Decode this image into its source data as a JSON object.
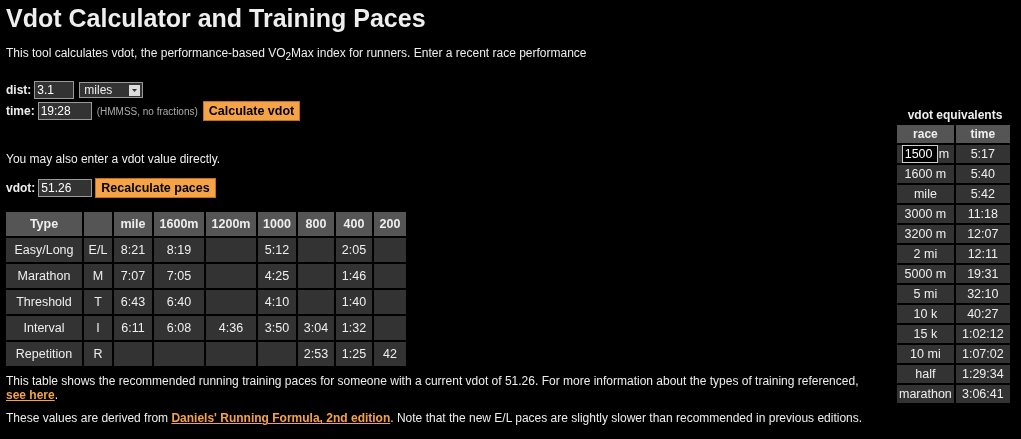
{
  "title": "Vdot Calculator and Training Paces",
  "intro": "This tool calculates vdot, the performance-based VO$_{2}$Max index for runners. Enter a recent race performance",
  "race_form": {
    "dist_label": "dist:",
    "dist_value": "3.1",
    "unit": "miles",
    "time_label": "time:",
    "time_value": "19:28",
    "time_hint": "(HMMSS, no fractions)",
    "button": "Calculate vdot"
  },
  "direct_note": "You may also enter a vdot value directly.",
  "vdot_form": {
    "label": "vdot:",
    "value": "51.26",
    "button": "Recalculate paces"
  },
  "pace_table": {
    "columns": [
      "Type",
      null,
      "mile",
      "1600m",
      "1200m",
      "1000",
      "800",
      "400",
      "200"
    ],
    "rows": [
      [
        "Easy/Long",
        "E/L",
        "8:21",
        "8:19",
        null,
        "5:12",
        null,
        "2:05",
        null
      ],
      [
        "Marathon",
        "M",
        "7:07",
        "7:05",
        null,
        "4:25",
        null,
        "1:46",
        null
      ],
      [
        "Threshold",
        "T",
        "6:43",
        "6:40",
        null,
        "4:10",
        null,
        "1:40",
        null
      ],
      [
        "Interval",
        "I",
        "6:11",
        "6:08",
        "4:36",
        "3:50",
        "3:04",
        "1:32",
        null
      ],
      [
        "Repetition",
        "R",
        null,
        null,
        null,
        null,
        "2:53",
        "1:25",
        "42"
      ]
    ]
  },
  "paragraphs": [
    {
      "before": "This table shows the recommended running training paces for someone with a current vdot of 51.26. For more information about the types of training referenced, ",
      "link": "see here",
      "after": "."
    },
    {
      "before": "These values are derived from ",
      "link": "Daniels' Running Formula, 2nd edition",
      "after": ". Note that the new E/L paces are slightly slower than recommended in previous editions."
    }
  ],
  "equivalents": {
    "title": "vdot equivalents",
    "columns": [
      "race",
      "time"
    ],
    "rows": [
      {
        "kind": "input",
        "race": "1500",
        "unit": "m",
        "time": "5:17"
      },
      {
        "kind": "text",
        "race": "1600 m",
        "time": "5:40"
      },
      {
        "kind": "text",
        "race": "mile",
        "time": "5:42"
      },
      {
        "kind": "text",
        "race": "3000 m",
        "time": "11:18"
      },
      {
        "kind": "text",
        "race": "3200 m",
        "time": "12:07"
      },
      {
        "kind": "text",
        "race": "2 mi",
        "time": "12:11"
      },
      {
        "kind": "text",
        "race": "5000 m",
        "time": "19:31"
      },
      {
        "kind": "text",
        "race": "5 mi",
        "time": "32:10"
      },
      {
        "kind": "text",
        "race": "10 k",
        "time": "40:27"
      },
      {
        "kind": "text",
        "race": "15 k",
        "time": "1:02:12"
      },
      {
        "kind": "text",
        "race": "10 mi",
        "time": "1:07:02"
      },
      {
        "kind": "text",
        "race": "half",
        "time": "1:29:34"
      },
      {
        "kind": "text",
        "race": "marathon",
        "time": "3:06:41"
      }
    ]
  }
}
